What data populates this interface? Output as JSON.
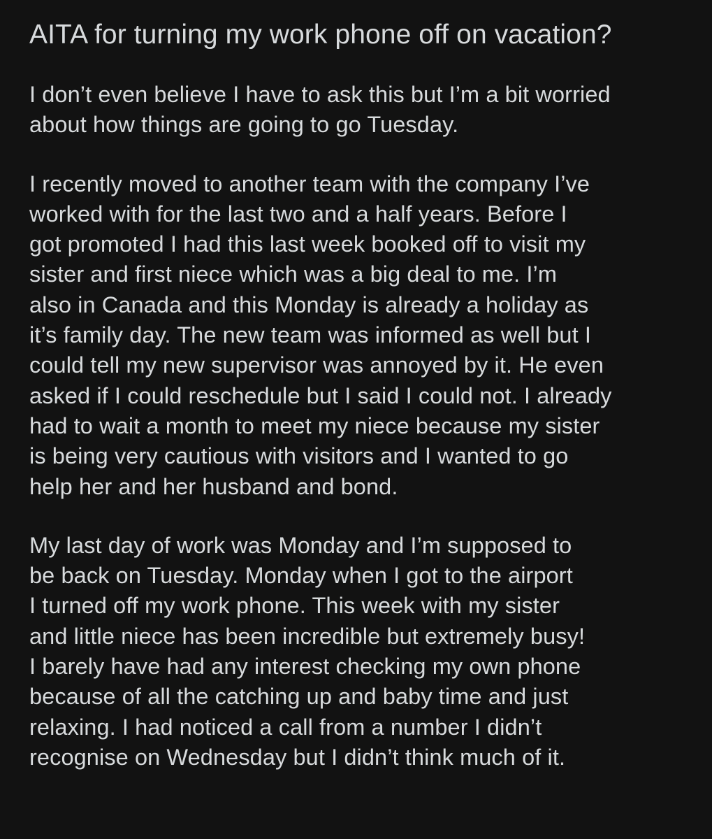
{
  "post": {
    "title": "AITA for turning my work phone off on vacation?",
    "paragraphs": [
      {
        "lines": [
          "I don’t even believe I have to ask this but I’m a bit worried",
          "about how things are going to go Tuesday."
        ]
      },
      {
        "lines": [
          "I recently moved to another team with the company I’ve",
          "worked with for the last two and a half years. Before I",
          "got promoted I had this last week booked off to visit my",
          "sister and first niece which was a big deal to me. I’m",
          "also in Canada and this Monday is already a holiday as",
          "it’s family day. The new team was informed as well but I",
          "could tell my new supervisor was annoyed by it. He even",
          "asked if I could reschedule but I said I could not. I already",
          "had to wait a month to meet my niece because my sister",
          "is being very cautious with visitors and I wanted to go",
          "help her and her husband and bond."
        ]
      },
      {
        "lines": [
          "My last day of work was Monday and I’m supposed to",
          "be back on Tuesday. Monday when I got to the airport",
          "I turned off my work phone. This week with my sister",
          "and little niece has been incredible but extremely busy!",
          "I barely have had any interest checking my own phone",
          "because of all the catching up and baby time and just",
          "relaxing. I had noticed a call from a number I didn’t",
          "recognise on Wednesday but I didn’t think much of it."
        ]
      }
    ]
  }
}
